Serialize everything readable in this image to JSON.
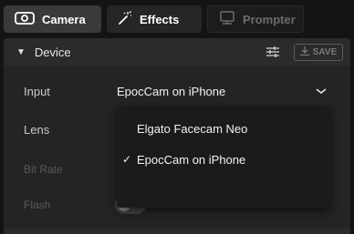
{
  "tabs": [
    {
      "label": "Camera",
      "icon": "camera-icon",
      "state": "active"
    },
    {
      "label": "Effects",
      "icon": "magic-wand-icon",
      "state": "normal"
    },
    {
      "label": "Prompter",
      "icon": "prompter-icon",
      "state": "disabled"
    }
  ],
  "panel": {
    "title": "Device",
    "settings_icon": "sliders-icon",
    "save_label": "SAVE",
    "save_icon": "download-icon"
  },
  "fields": {
    "input_label": "Input",
    "input_value": "EpocCam on iPhone",
    "lens_label": "Lens",
    "bitrate_label": "Bit Rate",
    "flash_label": "Flash",
    "flash_on": false
  },
  "dropdown": {
    "options": [
      {
        "label": "Elgato Facecam Neo",
        "selected": false,
        "check": ""
      },
      {
        "label": "EpocCam on iPhone",
        "selected": true,
        "check": "✓"
      }
    ]
  },
  "colors": {
    "background": "#141414",
    "panel": "#242424",
    "active_tab": "#3a3a3a",
    "disabled_text": "#6c6c6c"
  }
}
